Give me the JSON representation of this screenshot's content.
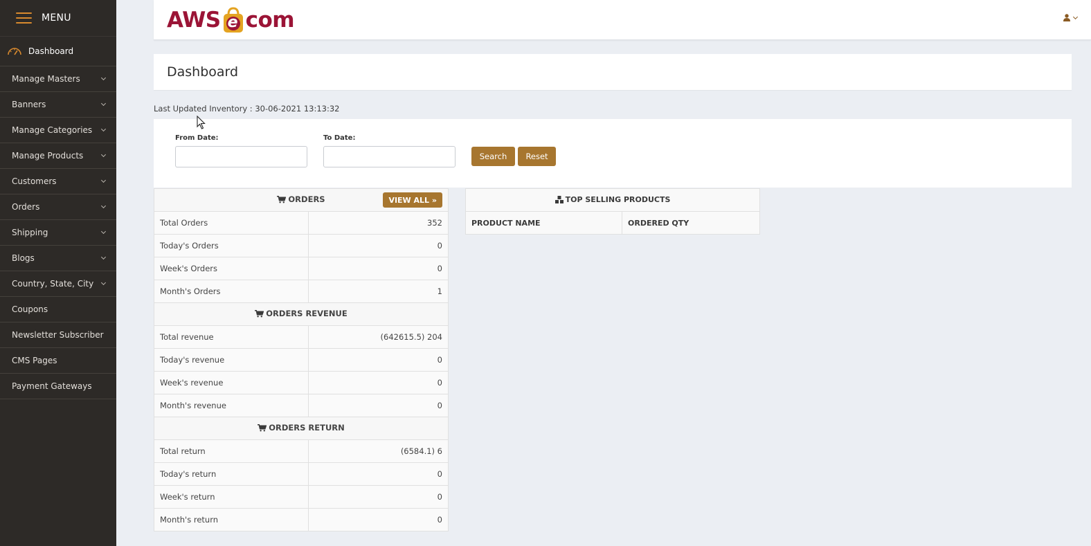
{
  "sidebar": {
    "menu_label": "MENU",
    "dashboard_label": "Dashboard",
    "items": [
      {
        "label": "Manage Masters",
        "expandable": true
      },
      {
        "label": "Banners",
        "expandable": true
      },
      {
        "label": "Manage Categories",
        "expandable": true
      },
      {
        "label": "Manage Products",
        "expandable": true
      },
      {
        "label": "Customers",
        "expandable": true
      },
      {
        "label": "Orders",
        "expandable": true
      },
      {
        "label": "Shipping",
        "expandable": true
      },
      {
        "label": "Blogs",
        "expandable": true
      },
      {
        "label": "Country, State, City",
        "expandable": true
      },
      {
        "label": "Coupons",
        "expandable": false
      },
      {
        "label": "Newsletter Subscriber",
        "expandable": false
      },
      {
        "label": "CMS Pages",
        "expandable": false
      },
      {
        "label": "Payment Gateways",
        "expandable": false
      }
    ]
  },
  "header": {
    "logo_left": "AWS",
    "logo_mid": "e",
    "logo_right": "com"
  },
  "page": {
    "title": "Dashboard",
    "last_updated": "Last Updated Inventory : 30-06-2021 13:13:32"
  },
  "filter": {
    "from_label": "From Date:",
    "to_label": "To Date:",
    "from_value": "",
    "to_value": "",
    "search_label": "Search",
    "reset_label": "Reset"
  },
  "orders": {
    "heading": "ORDERS",
    "view_all": "VIEW ALL »",
    "rows": [
      {
        "label": "Total Orders",
        "value": "352"
      },
      {
        "label": "Today's Orders",
        "value": "0"
      },
      {
        "label": "Week's Orders",
        "value": "0"
      },
      {
        "label": "Month's Orders",
        "value": "1"
      }
    ]
  },
  "revenue": {
    "heading": "ORDERS REVENUE",
    "rows": [
      {
        "label": "Total revenue",
        "value": "(642615.5) 204"
      },
      {
        "label": "Today's revenue",
        "value": "0"
      },
      {
        "label": "Week's revenue",
        "value": "0"
      },
      {
        "label": "Month's revenue",
        "value": "0"
      }
    ]
  },
  "returns": {
    "heading": "ORDERS RETURN",
    "rows": [
      {
        "label": "Total return",
        "value": "(6584.1) 6"
      },
      {
        "label": "Today's return",
        "value": "0"
      },
      {
        "label": "Week's return",
        "value": "0"
      },
      {
        "label": "Month's return",
        "value": "0"
      }
    ]
  },
  "top_selling": {
    "heading": "TOP SELLING PRODUCTS",
    "col_product": "PRODUCT NAME",
    "col_qty": "ORDERED QTY"
  },
  "colors": {
    "sidebar_bg": "#2d2a27",
    "accent": "#a7762f",
    "brand": "#9b1436",
    "hamburger": "#d98a2e"
  }
}
